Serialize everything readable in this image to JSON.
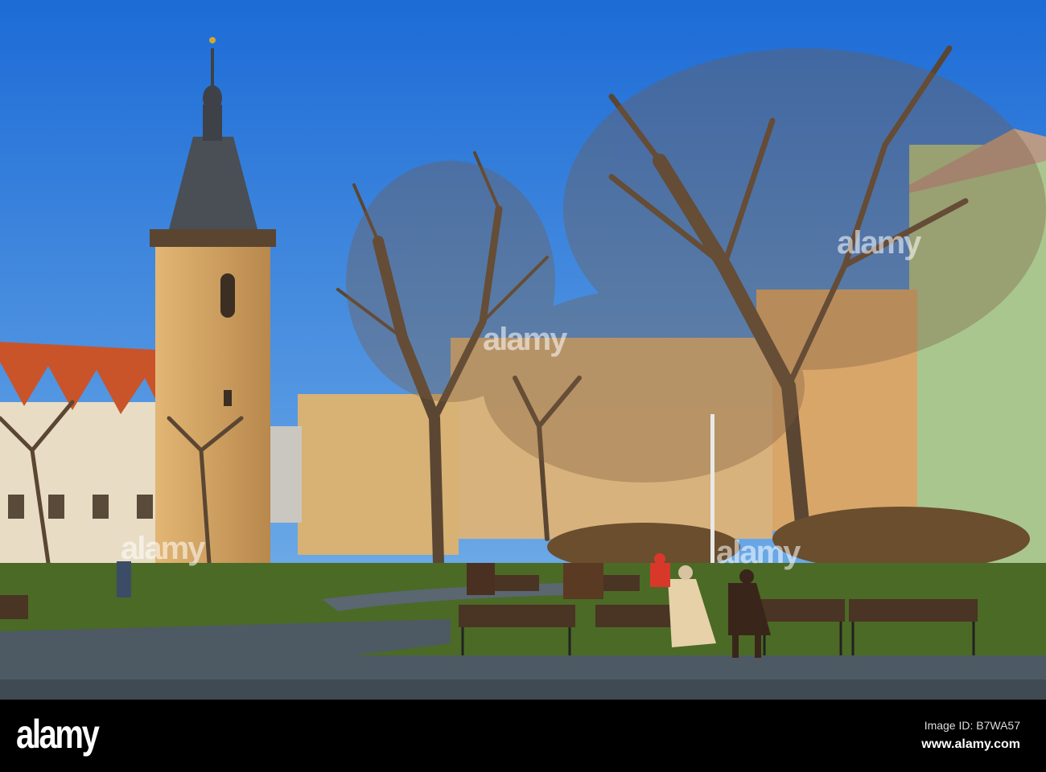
{
  "watermark": {
    "logo_text": "alamy"
  },
  "footer": {
    "logo": "alamy",
    "image_id": "Image ID: B7WA57",
    "url": "www.alamy.com"
  },
  "colors": {
    "sky_top": "#1f6fd8",
    "sky_bottom": "#5fa3e8",
    "roof": "#c9542a",
    "grass": "#4b6a25",
    "path": "#4d5a63"
  }
}
